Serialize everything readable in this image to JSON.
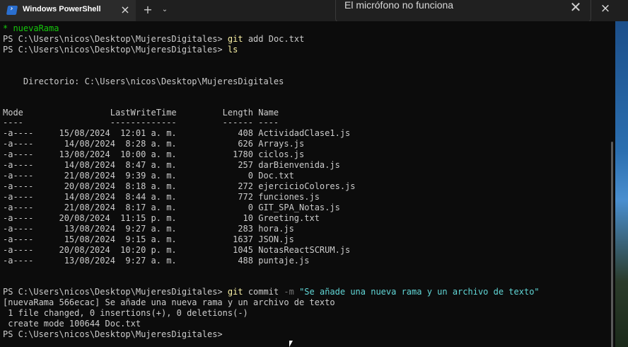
{
  "window": {
    "tab_title": "Windows PowerShell",
    "tab_icon": "powershell-icon",
    "close_glyph": "×",
    "new_tab_glyph": "+",
    "dropdown_glyph": "⌄"
  },
  "notification": {
    "text": "El micrófono no funciona",
    "close_glyph": "✕"
  },
  "terminal": {
    "branch_line": "* nuevaRama",
    "prompt": "PS C:\\Users\\nicos\\Desktop\\MujeresDigitales>",
    "cmd1": "git",
    "cmd1_args": " add Doc.txt",
    "cmd2": "ls",
    "dir_line": "    Directorio: C:\\Users\\nicos\\Desktop\\MujeresDigitales",
    "header": "Mode                 LastWriteTime         Length Name",
    "header_rule": "----                 -------------         ------ ----",
    "files": [
      "-a----     15/08/2024  12:01 a. m.            408 ActividadClase1.js",
      "-a----      14/08/2024  8:28 a. m.            626 Arrays.js",
      "-a----     13/08/2024  10:00 a. m.           1780 ciclos.js",
      "-a----      14/08/2024  8:47 a. m.            257 darBienvenida.js",
      "-a----      21/08/2024  9:39 a. m.              0 Doc.txt",
      "-a----      20/08/2024  8:18 a. m.            272 ejercicioColores.js",
      "-a----      14/08/2024  8:44 a. m.            772 funciones.js",
      "-a----      21/08/2024  8:17 a. m.              0 GIT_SPA_Notas.js",
      "-a----     20/08/2024  11:15 p. m.             10 Greeting.txt",
      "-a----      13/08/2024  9:27 a. m.            283 hora.js",
      "-a----      15/08/2024  9:15 a. m.           1637 JSON.js",
      "-a----     20/08/2024  10:20 p. m.           1045 NotasReactSCRUM.js",
      "-a----      13/08/2024  9:27 a. m.            488 puntaje.js"
    ],
    "cmd3": "git",
    "cmd3_sub": " commit",
    "cmd3_flag": " -m",
    "cmd3_msg": " \"Se añade una nueva rama y un archivo de texto\"",
    "out1": "[nuevaRama 566ecac] Se añade una nueva rama y un archivo de texto",
    "out2": " 1 file changed, 0 insertions(+), 0 deletions(-)",
    "out3": " create mode 100644 Doc.txt"
  }
}
